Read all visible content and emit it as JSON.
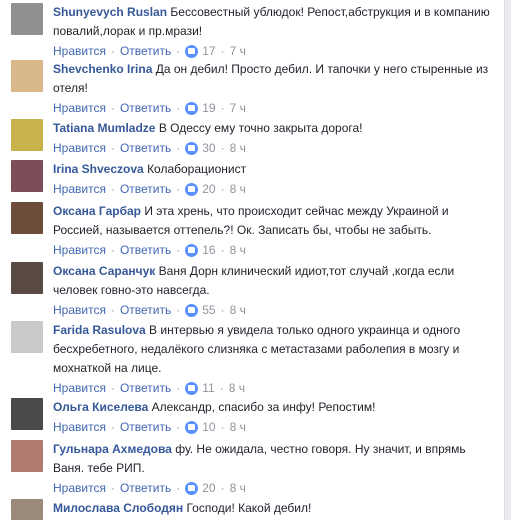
{
  "labels": {
    "like": "Нравится",
    "reply": "Ответить",
    "separator": "·"
  },
  "comments": [
    {
      "author": "Shunyevych Ruslan",
      "text": "Бессовестный ублюдок! Репост,абструкция и в компанию повалий,лорак и пр.мрази!",
      "likes": "17",
      "time": "7 ч",
      "avatar_color": "#8f8f8f"
    },
    {
      "author": "Shevchenko Irina",
      "text": "Да он дебил! Просто дебил. И тапочки у него стыренные из отеля!",
      "likes": "19",
      "time": "7 ч",
      "avatar_color": "#d8b88a"
    },
    {
      "author": "Tatiana Mumladze",
      "text": "В Одессу ему точно закрыта дорога!",
      "likes": "30",
      "time": "8 ч",
      "avatar_color": "#c8b24a"
    },
    {
      "author": "Irina Shveczova",
      "text": "Колаборационист",
      "likes": "20",
      "time": "8 ч",
      "avatar_color": "#7d4d5a"
    },
    {
      "author": "Оксана Гарбар",
      "text": "И эта хрень, что происходит сейчас между Украиной и Россией, называется оттепель?! Ок. Записать бы, чтобы не забыть.",
      "likes": "16",
      "time": "8 ч",
      "avatar_color": "#6e4c3a"
    },
    {
      "author": "Оксана Саранчук",
      "text": "Ваня Дорн клинический идиот,тот случай ,когда если человек говно-это навсегда.",
      "likes": "55",
      "time": "8 ч",
      "avatar_color": "#5a4a44"
    },
    {
      "author": "Farida Rasulova",
      "text": "В интервью я увидела только одного украинца и одного бесхребетного, недалёкого слизняка с метастазами раболепия в мозгу и мохнаткой на лице.",
      "likes": "11",
      "time": "8 ч",
      "avatar_color": "#c9c9c9"
    },
    {
      "author": "Ольга Киселева",
      "text": "Александр, спасибо за инфу! Репостим!",
      "likes": "10",
      "time": "8 ч",
      "avatar_color": "#4a4a4a"
    },
    {
      "author": "Гульнара Ахмедова",
      "text": "фу. Не ожидала, честно говоря. Ну значит, и впрямь Ваня. тебе РИП.",
      "likes": "20",
      "time": "8 ч",
      "avatar_color": "#b07a70"
    },
    {
      "author": "Милослава Слободян",
      "text": "Господи! Какой дебил!",
      "likes": "",
      "time": "",
      "avatar_color": "#9a8a7a"
    }
  ]
}
